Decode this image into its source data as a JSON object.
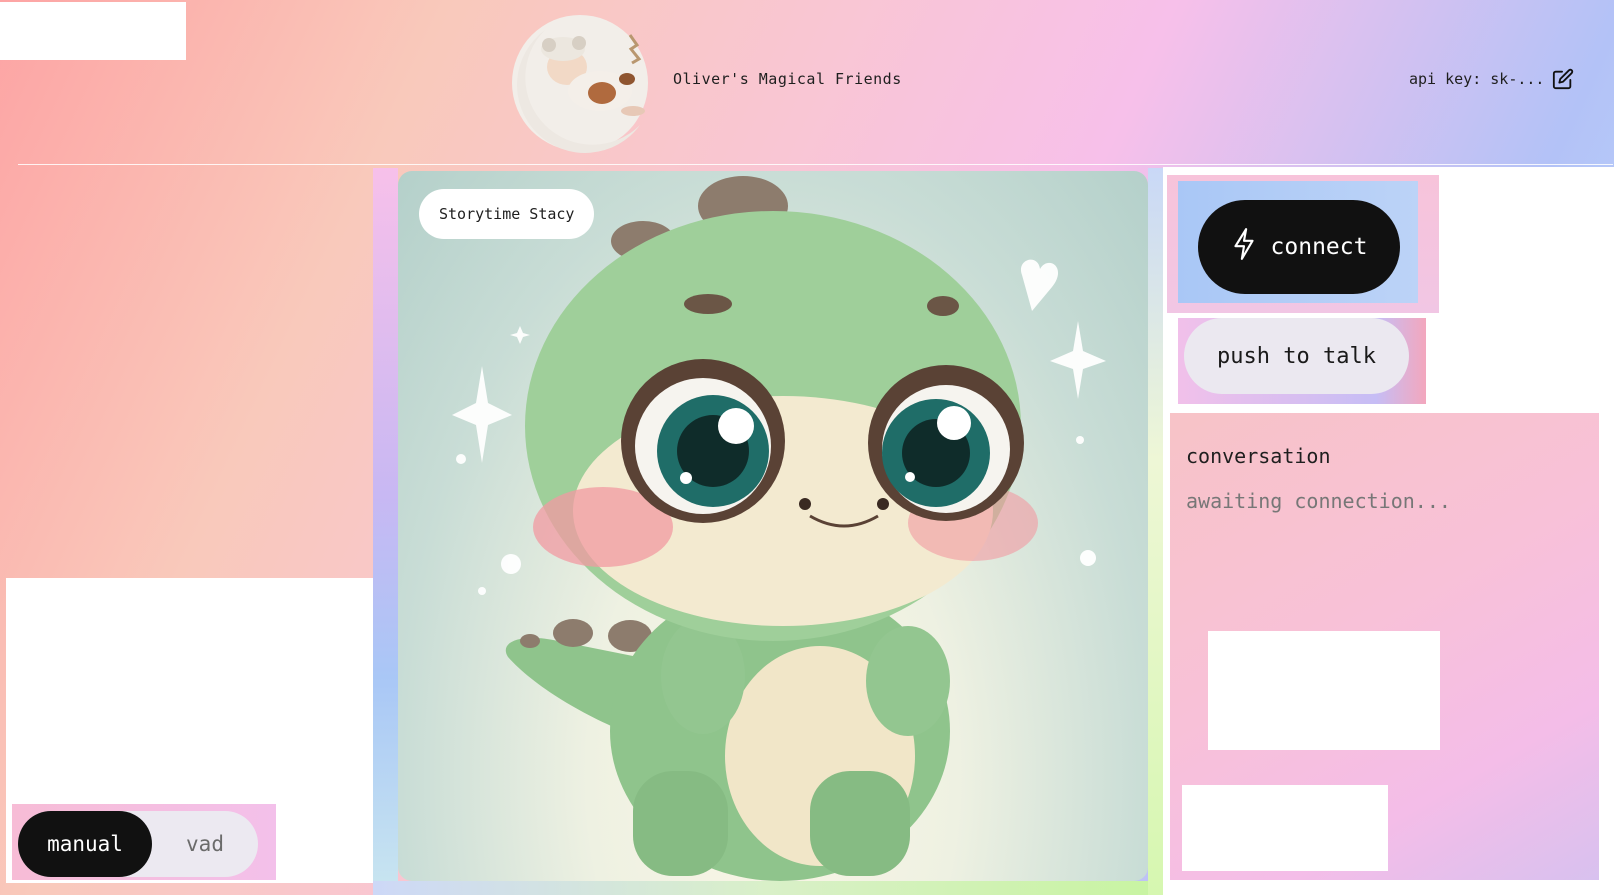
{
  "header": {
    "title": "Oliver's Magical Friends",
    "api_key_label": "api key: sk-..."
  },
  "character": {
    "name": "Storytime Stacy"
  },
  "mode_toggle": {
    "options": [
      "manual",
      "vad"
    ],
    "selected": "manual"
  },
  "controls": {
    "connect_label": "connect",
    "push_to_talk_label": "push to talk"
  },
  "conversation": {
    "title": "conversation",
    "status": "awaiting connection..."
  },
  "colors": {
    "button_dark": "#111111",
    "dino_green": "#8fc48c",
    "panel_pink": "#f8c1d8"
  },
  "icons": [
    "baby-moon-logo",
    "edit-icon",
    "lightning-icon"
  ]
}
